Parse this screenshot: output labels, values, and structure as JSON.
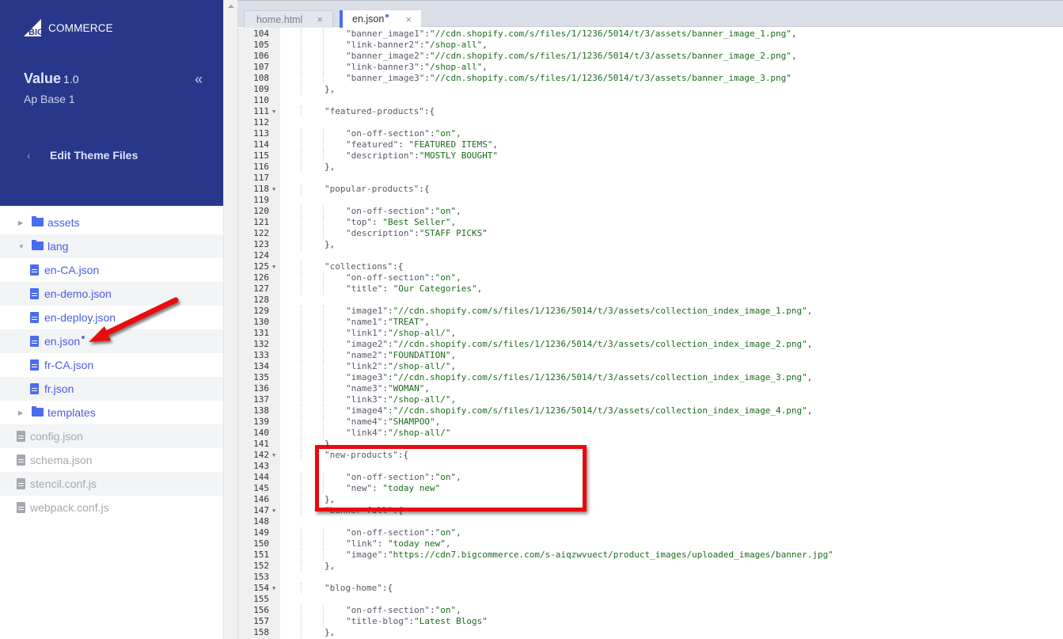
{
  "app": {
    "brand": "BIGCOMMERCE",
    "brand_big": "BIG",
    "brand_rest": "COMMERCE"
  },
  "sidebar": {
    "theme_name": "Value",
    "theme_version": "1.0",
    "theme_variant": "Ap Base 1",
    "collapse_icon": "«",
    "back_icon": "‹",
    "section_title": "Edit Theme Files",
    "tree": [
      {
        "type": "folder",
        "label": "assets",
        "expanded": false
      },
      {
        "type": "folder",
        "label": "lang",
        "expanded": true
      },
      {
        "type": "file",
        "label": "en-CA.json",
        "nested": true
      },
      {
        "type": "file",
        "label": "en-demo.json",
        "nested": true
      },
      {
        "type": "file",
        "label": "en-deploy.json",
        "nested": true
      },
      {
        "type": "file",
        "label": "en.json",
        "nested": true,
        "modified": true
      },
      {
        "type": "file",
        "label": "fr-CA.json",
        "nested": true
      },
      {
        "type": "file",
        "label": "fr.json",
        "nested": true
      },
      {
        "type": "folder",
        "label": "templates",
        "expanded": false
      },
      {
        "type": "file",
        "label": "config.json",
        "nested": false
      },
      {
        "type": "file",
        "label": "schema.json",
        "nested": false
      },
      {
        "type": "file",
        "label": "stencil.conf.js",
        "nested": false
      },
      {
        "type": "file",
        "label": "webpack.conf.js",
        "nested": false
      }
    ]
  },
  "editor": {
    "tabs": [
      {
        "label": "home.html",
        "active": false,
        "modified": false,
        "close_icon": "×"
      },
      {
        "label": "en.json",
        "active": true,
        "modified": true,
        "close_icon": "×"
      }
    ],
    "lines": [
      {
        "n": 104,
        "indent": 2,
        "text": "\"banner_image1\":\"//cdn.shopify.com/s/files/1/1236/5014/t/3/assets/banner_image_1.png\","
      },
      {
        "n": 105,
        "indent": 2,
        "text": "\"link-banner2\":\"/shop-all\","
      },
      {
        "n": 106,
        "indent": 2,
        "text": "\"banner_image2\":\"//cdn.shopify.com/s/files/1/1236/5014/t/3/assets/banner_image_2.png\","
      },
      {
        "n": 107,
        "indent": 2,
        "text": "\"link-banner3\":\"/shop-all\","
      },
      {
        "n": 108,
        "indent": 2,
        "text": "\"banner_image3\":\"//cdn.shopify.com/s/files/1/1236/5014/t/3/assets/banner_image_3.png\""
      },
      {
        "n": 109,
        "indent": 1,
        "text": "},"
      },
      {
        "n": 110,
        "indent": 0,
        "text": ""
      },
      {
        "n": 111,
        "indent": 1,
        "fold": true,
        "text": "\"featured-products\":{"
      },
      {
        "n": 112,
        "indent": 0,
        "text": ""
      },
      {
        "n": 113,
        "indent": 2,
        "text": "\"on-off-section\":\"on\","
      },
      {
        "n": 114,
        "indent": 2,
        "text": "\"featured\": \"FEATURED ITEMS\","
      },
      {
        "n": 115,
        "indent": 2,
        "text": "\"description\":\"MOSTLY BOUGHT\""
      },
      {
        "n": 116,
        "indent": 1,
        "text": "},"
      },
      {
        "n": 117,
        "indent": 0,
        "text": ""
      },
      {
        "n": 118,
        "indent": 1,
        "fold": true,
        "text": "\"popular-products\":{"
      },
      {
        "n": 119,
        "indent": 0,
        "text": ""
      },
      {
        "n": 120,
        "indent": 2,
        "text": "\"on-off-section\":\"on\","
      },
      {
        "n": 121,
        "indent": 2,
        "text": "\"top\": \"Best Seller\","
      },
      {
        "n": 122,
        "indent": 2,
        "text": "\"description\":\"STAFF PICKS\""
      },
      {
        "n": 123,
        "indent": 1,
        "text": "},"
      },
      {
        "n": 124,
        "indent": 0,
        "text": ""
      },
      {
        "n": 125,
        "indent": 1,
        "fold": true,
        "text": "\"collections\":{"
      },
      {
        "n": 126,
        "indent": 2,
        "text": "\"on-off-section\":\"on\","
      },
      {
        "n": 127,
        "indent": 2,
        "text": "\"title\": \"Our Categories\","
      },
      {
        "n": 128,
        "indent": 0,
        "text": ""
      },
      {
        "n": 129,
        "indent": 2,
        "text": "\"image1\":\"//cdn.shopify.com/s/files/1/1236/5014/t/3/assets/collection_index_image_1.png\","
      },
      {
        "n": 130,
        "indent": 2,
        "text": "\"name1\":\"TREAT\","
      },
      {
        "n": 131,
        "indent": 2,
        "text": "\"link1\":\"/shop-all/\","
      },
      {
        "n": 132,
        "indent": 2,
        "text": "\"image2\":\"//cdn.shopify.com/s/files/1/1236/5014/t/3/assets/collection_index_image_2.png\","
      },
      {
        "n": 133,
        "indent": 2,
        "text": "\"name2\":\"FOUNDATION\","
      },
      {
        "n": 134,
        "indent": 2,
        "text": "\"link2\":\"/shop-all/\","
      },
      {
        "n": 135,
        "indent": 2,
        "text": "\"image3\":\"//cdn.shopify.com/s/files/1/1236/5014/t/3/assets/collection_index_image_3.png\","
      },
      {
        "n": 136,
        "indent": 2,
        "text": "\"name3\":\"WOMAN\","
      },
      {
        "n": 137,
        "indent": 2,
        "text": "\"link3\":\"/shop-all/\","
      },
      {
        "n": 138,
        "indent": 2,
        "text": "\"image4\":\"//cdn.shopify.com/s/files/1/1236/5014/t/3/assets/collection_index_image_4.png\","
      },
      {
        "n": 139,
        "indent": 2,
        "text": "\"name4\":\"SHAMPOO\","
      },
      {
        "n": 140,
        "indent": 2,
        "text": "\"link4\":\"/shop-all/\""
      },
      {
        "n": 141,
        "indent": 1,
        "text": "},"
      },
      {
        "n": 142,
        "indent": 1,
        "fold": true,
        "text": "\"new-products\":{"
      },
      {
        "n": 143,
        "indent": 0,
        "text": ""
      },
      {
        "n": 144,
        "indent": 2,
        "text": "\"on-off-section\":\"on\","
      },
      {
        "n": 145,
        "indent": 2,
        "text": "\"new\": \"today new\""
      },
      {
        "n": 146,
        "indent": 1,
        "text": "},"
      },
      {
        "n": 147,
        "indent": 1,
        "fold": true,
        "text": "\"banner-full\":{"
      },
      {
        "n": 148,
        "indent": 0,
        "text": ""
      },
      {
        "n": 149,
        "indent": 2,
        "text": "\"on-off-section\":\"on\","
      },
      {
        "n": 150,
        "indent": 2,
        "text": "\"link\": \"today new\","
      },
      {
        "n": 151,
        "indent": 2,
        "text": "\"image\":\"https://cdn7.bigcommerce.com/s-aiqzwvuect/product_images/uploaded_images/banner.jpg\""
      },
      {
        "n": 152,
        "indent": 1,
        "text": "},"
      },
      {
        "n": 153,
        "indent": 0,
        "text": ""
      },
      {
        "n": 154,
        "indent": 1,
        "fold": true,
        "text": "\"blog-home\":{"
      },
      {
        "n": 155,
        "indent": 0,
        "text": ""
      },
      {
        "n": 156,
        "indent": 2,
        "text": "\"on-off-section\":\"on\","
      },
      {
        "n": 157,
        "indent": 2,
        "text": "\"title-blog\":\"Latest Blogs\""
      },
      {
        "n": 158,
        "indent": 1,
        "text": "},"
      }
    ]
  },
  "annotations": {
    "highlight_color": "#e8090f",
    "highlight_target": "new-products block (lines 142-146)",
    "arrow_target": "en.json"
  },
  "colors": {
    "sidebar_header_bg": "#29378a",
    "accent": "#4a6cf0",
    "string": "#1d6b1d",
    "tabbar_bg": "#dadee6"
  }
}
